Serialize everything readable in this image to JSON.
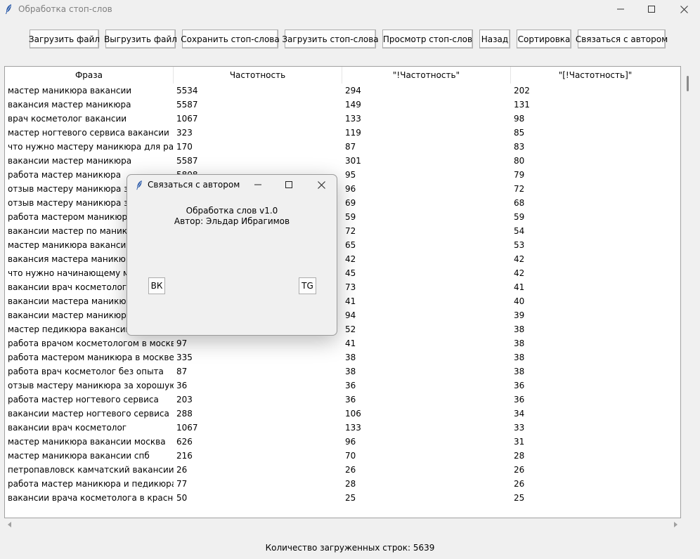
{
  "window": {
    "title": "Обработка стоп-слов"
  },
  "toolbar": {
    "buttons": [
      "Загрузить файл",
      "Выгрузить файл",
      "Сохранить стоп-слова",
      "Загрузить стоп-слова",
      "Просмотр стоп-слов",
      "Назад",
      "Сортировка",
      "Связаться с автором"
    ]
  },
  "table": {
    "columns": [
      "Фраза",
      "Частотность",
      "\"!Частотность\"",
      "\"[!Частотность]\""
    ],
    "rows": [
      [
        "мастер маникюра вакансии",
        "5534",
        "294",
        "202"
      ],
      [
        "вакансия мастер маникюра",
        "5587",
        "149",
        "131"
      ],
      [
        "врач косметолог вакансии",
        "1067",
        "133",
        "98"
      ],
      [
        "мастер ногтевого сервиса вакансии",
        "323",
        "119",
        "85"
      ],
      [
        "что нужно мастеру маникюра для работы",
        "170",
        "87",
        "83"
      ],
      [
        "вакансии мастер маникюра",
        "5587",
        "301",
        "80"
      ],
      [
        "работа мастер маникюра",
        "5808",
        "95",
        "79"
      ],
      [
        "отзыв мастеру маникюра за хорошую работу",
        "",
        "96",
        "72"
      ],
      [
        "отзыв мастеру маникюра за хорошую",
        "",
        "69",
        "68"
      ],
      [
        "работа мастером маникюра",
        "",
        "59",
        "59"
      ],
      [
        "вакансии мастер по маникюру",
        "",
        "72",
        "54"
      ],
      [
        "мастер маникюра вакансии в москве",
        "",
        "65",
        "53"
      ],
      [
        "вакансия мастера маникюра",
        "",
        "42",
        "42"
      ],
      [
        "что нужно начинающему мастеру маникюра",
        "",
        "45",
        "42"
      ],
      [
        "вакансии врач косметолог москва",
        "",
        "73",
        "41"
      ],
      [
        "вакансии мастера маникюра",
        "",
        "41",
        "40"
      ],
      [
        "вакансии мастер маникюра москва",
        "",
        "94",
        "39"
      ],
      [
        "мастер педикюра вакансии",
        "",
        "52",
        "38"
      ],
      [
        "работа врачом косметологом в москве",
        "97",
        "41",
        "38"
      ],
      [
        "работа мастером маникюра в москве",
        "335",
        "38",
        "38"
      ],
      [
        "работа врач косметолог без опыта",
        "87",
        "38",
        "38"
      ],
      [
        "отзыв мастеру маникюра за хорошую работу",
        "36",
        "36",
        "36"
      ],
      [
        "работа мастер ногтевого сервиса",
        "203",
        "36",
        "36"
      ],
      [
        "вакансии мастер ногтевого сервиса",
        "288",
        "106",
        "34"
      ],
      [
        "вакансии врач косметолог",
        "1067",
        "133",
        "33"
      ],
      [
        "мастер маникюра вакансии москва",
        "626",
        "96",
        "31"
      ],
      [
        "мастер маникюра вакансии спб",
        "216",
        "70",
        "28"
      ],
      [
        "петропавловск камчатский вакансии врач",
        "26",
        "26",
        "26"
      ],
      [
        "работа мастер маникюра и педикюра в москве",
        "77",
        "28",
        "26"
      ],
      [
        "вакансии врача косметолога в краснодаре",
        "50",
        "25",
        "25"
      ]
    ]
  },
  "status": {
    "text": "Количество загруженных строк: 5639"
  },
  "dialog": {
    "title": "Связаться с автором",
    "line1": "Обработка слов v1.0",
    "line2": "Автор: Эльдар Ибрагимов",
    "btn_vk": "ВК",
    "btn_tg": "TG"
  }
}
